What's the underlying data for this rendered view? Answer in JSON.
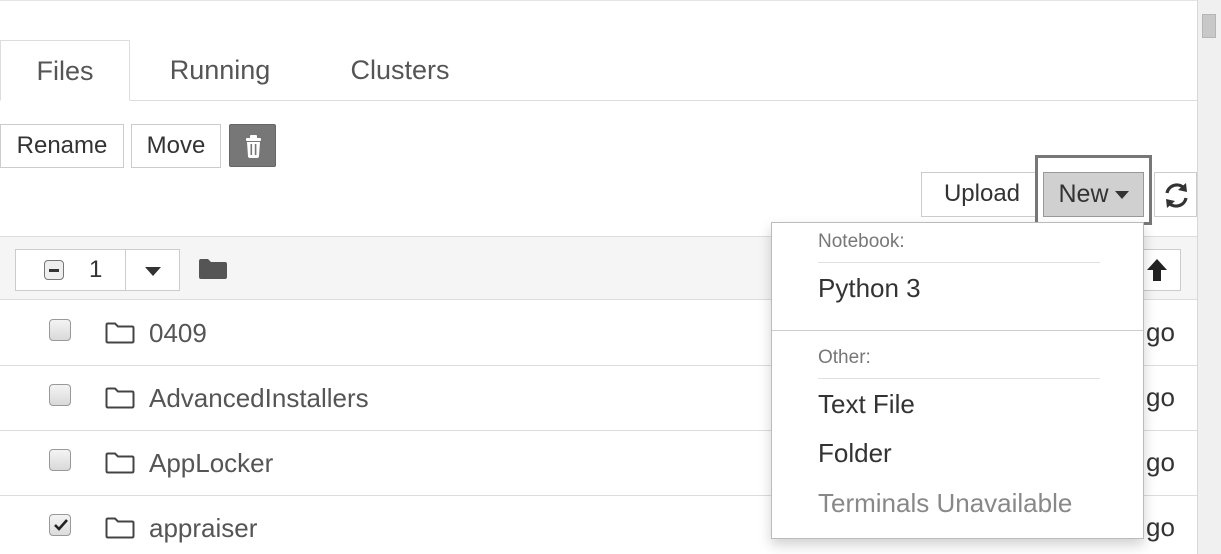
{
  "tabs": [
    {
      "label": "Files",
      "active": true
    },
    {
      "label": "Running",
      "active": false
    },
    {
      "label": "Clusters",
      "active": false
    }
  ],
  "toolbar": {
    "rename_label": "Rename",
    "move_label": "Move",
    "delete_icon": "trash-icon",
    "upload_label": "Upload",
    "new_label": "New",
    "refresh_icon": "refresh-icon"
  },
  "list_header": {
    "selected_count": "1",
    "select_state": "partial",
    "folder_icon": "folder-icon",
    "sort_icon": "arrow-up-icon"
  },
  "rows": [
    {
      "name": "0409",
      "checked": false,
      "time": "go"
    },
    {
      "name": "AdvancedInstallers",
      "checked": false,
      "time": "go"
    },
    {
      "name": "AppLocker",
      "checked": false,
      "time": "go"
    },
    {
      "name": "appraiser",
      "checked": true,
      "time": "go"
    }
  ],
  "new_menu": {
    "notebook_header": "Notebook:",
    "python_item": "Python 3",
    "other_header": "Other:",
    "text_file_item": "Text File",
    "folder_item": "Folder",
    "terminals_item": "Terminals Unavailable"
  },
  "colors": {
    "trash_button": "#777777",
    "new_button": "#d0d0d0",
    "header_bg": "#f5f5f5"
  }
}
